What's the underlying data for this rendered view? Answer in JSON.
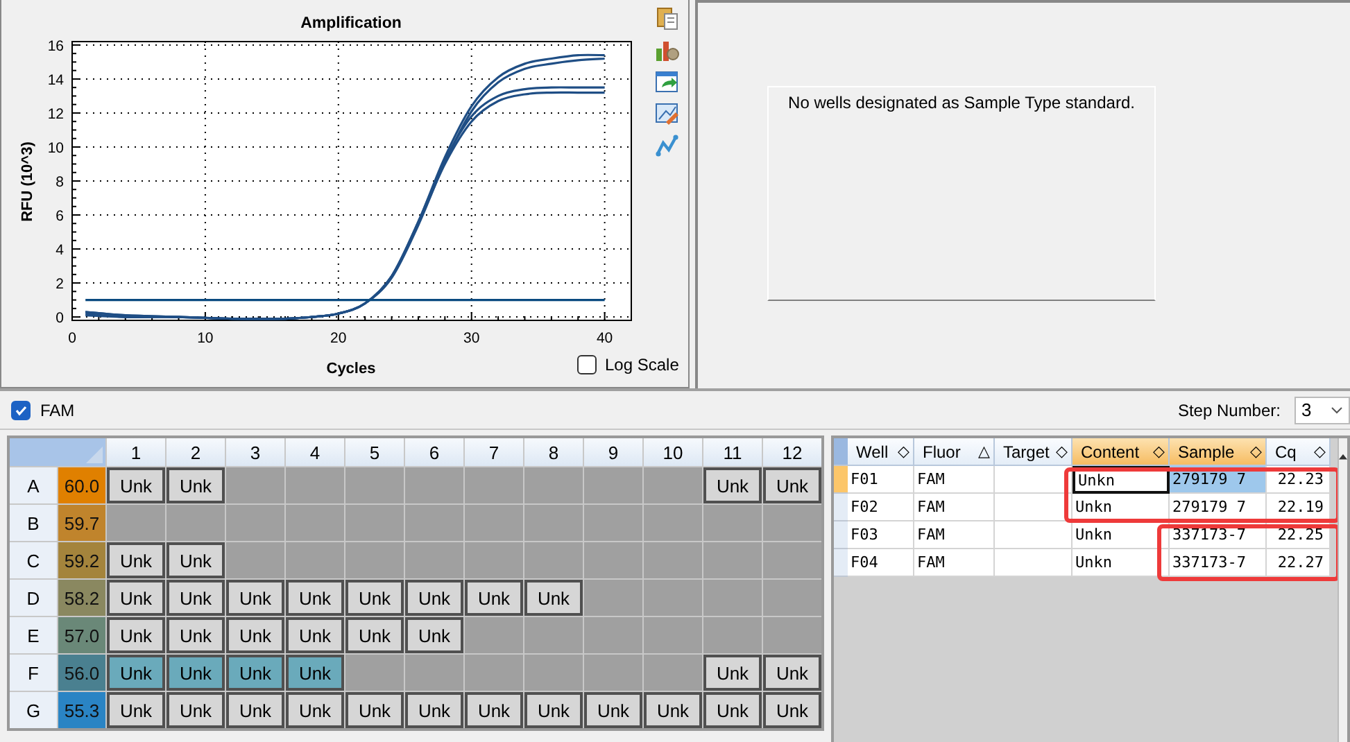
{
  "chart": {
    "chart_data": {
      "type": "line",
      "title": "Amplification",
      "xlabel": "Cycles",
      "ylabel": "RFU (10^3)",
      "x": [
        1,
        4,
        8,
        12,
        16,
        18,
        20,
        22,
        24,
        26,
        28,
        30,
        32,
        34,
        36,
        38,
        40
      ],
      "series": [
        {
          "color": "#1f4e85",
          "values": [
            0.3,
            0.1,
            0,
            -0.1,
            -0.1,
            0,
            0.2,
            0.8,
            2.4,
            5.6,
            9.4,
            12.4,
            14.1,
            14.9,
            15.2,
            15.4,
            15.4
          ]
        },
        {
          "color": "#1f4e85",
          "values": [
            0.1,
            0,
            0,
            -0.1,
            -0.1,
            0,
            0.2,
            0.8,
            2.3,
            5.4,
            9.1,
            12.1,
            13.8,
            14.6,
            14.9,
            15.1,
            15.2
          ]
        },
        {
          "color": "#1f4e85",
          "values": [
            0.3,
            0.1,
            0,
            -0.1,
            -0.1,
            0,
            0.2,
            0.8,
            2.4,
            5.6,
            9.2,
            11.8,
            13.0,
            13.4,
            13.5,
            13.5,
            13.5
          ]
        },
        {
          "color": "#1f4e85",
          "values": [
            0.2,
            0,
            0,
            -0.1,
            -0.1,
            0,
            0.2,
            0.8,
            2.4,
            5.5,
            9.0,
            11.5,
            12.7,
            13.1,
            13.2,
            13.2,
            13.2
          ]
        },
        {
          "color": "#0a4a80",
          "values": [
            1,
            1,
            1,
            1,
            1,
            1,
            1,
            1,
            1,
            1,
            1,
            1,
            1,
            1,
            1,
            1,
            1
          ]
        }
      ],
      "xlim": [
        0,
        42
      ],
      "ylim": [
        -0.2,
        16.2
      ],
      "xticks": [
        0,
        10,
        20,
        30,
        40
      ],
      "yticks": [
        0,
        2,
        4,
        6,
        8,
        10,
        12,
        14,
        16
      ],
      "grid": true
    },
    "log_scale": {
      "label": "Log Scale",
      "checked": false
    }
  },
  "standard_curve": {
    "message": "No wells designated as Sample Type standard."
  },
  "fluor_filter": {
    "label": "FAM",
    "checked": true
  },
  "step_number": {
    "label": "Step Number:",
    "value": "3"
  },
  "plate": {
    "columns": [
      "1",
      "2",
      "3",
      "4",
      "5",
      "6",
      "7",
      "8",
      "9",
      "10",
      "11",
      "12"
    ],
    "rows": [
      {
        "label": "A",
        "temp": "60.0",
        "color": "#e08000",
        "wells": [
          {
            "kind": "unk",
            "content": "Unk",
            "selected": false
          },
          {
            "kind": "unk",
            "content": "Unk",
            "selected": false
          },
          {
            "kind": "empty",
            "selected": false
          },
          {
            "kind": "empty",
            "selected": false
          },
          {
            "kind": "empty",
            "selected": false
          },
          {
            "kind": "empty",
            "selected": false
          },
          {
            "kind": "empty",
            "selected": false
          },
          {
            "kind": "empty",
            "selected": false
          },
          {
            "kind": "empty",
            "selected": false
          },
          {
            "kind": "empty",
            "selected": false
          },
          {
            "kind": "unk",
            "content": "Unk",
            "selected": false
          },
          {
            "kind": "unk",
            "content": "Unk",
            "selected": false
          }
        ]
      },
      {
        "label": "B",
        "temp": "59.7",
        "color": "#c0842c",
        "wells": [
          {
            "kind": "empty",
            "selected": false
          },
          {
            "kind": "empty",
            "selected": false
          },
          {
            "kind": "empty",
            "selected": false
          },
          {
            "kind": "empty",
            "selected": false
          },
          {
            "kind": "empty",
            "selected": false
          },
          {
            "kind": "empty",
            "selected": false
          },
          {
            "kind": "empty",
            "selected": false
          },
          {
            "kind": "empty",
            "selected": false
          },
          {
            "kind": "empty",
            "selected": false
          },
          {
            "kind": "empty",
            "selected": false
          },
          {
            "kind": "empty",
            "selected": false
          },
          {
            "kind": "empty",
            "selected": false
          }
        ]
      },
      {
        "label": "C",
        "temp": "59.2",
        "color": "#a4843c",
        "wells": [
          {
            "kind": "unk",
            "content": "Unk",
            "selected": false
          },
          {
            "kind": "unk",
            "content": "Unk",
            "selected": false
          },
          {
            "kind": "empty",
            "selected": false
          },
          {
            "kind": "empty",
            "selected": false
          },
          {
            "kind": "empty",
            "selected": false
          },
          {
            "kind": "empty",
            "selected": false
          },
          {
            "kind": "empty",
            "selected": false
          },
          {
            "kind": "empty",
            "selected": false
          },
          {
            "kind": "empty",
            "selected": false
          },
          {
            "kind": "empty",
            "selected": false
          },
          {
            "kind": "empty",
            "selected": false
          },
          {
            "kind": "empty",
            "selected": false
          }
        ]
      },
      {
        "label": "D",
        "temp": "58.2",
        "color": "#8a8860",
        "wells": [
          {
            "kind": "unk",
            "content": "Unk",
            "selected": false
          },
          {
            "kind": "unk",
            "content": "Unk",
            "selected": false
          },
          {
            "kind": "unk",
            "content": "Unk",
            "selected": false
          },
          {
            "kind": "unk",
            "content": "Unk",
            "selected": false
          },
          {
            "kind": "unk",
            "content": "Unk",
            "selected": false
          },
          {
            "kind": "unk",
            "content": "Unk",
            "selected": false
          },
          {
            "kind": "unk",
            "content": "Unk",
            "selected": false
          },
          {
            "kind": "unk",
            "content": "Unk",
            "selected": false
          },
          {
            "kind": "empty",
            "selected": false
          },
          {
            "kind": "empty",
            "selected": false
          },
          {
            "kind": "empty",
            "selected": false
          },
          {
            "kind": "empty",
            "selected": false
          }
        ]
      },
      {
        "label": "E",
        "temp": "57.0",
        "color": "#6a8878",
        "wells": [
          {
            "kind": "unk",
            "content": "Unk",
            "selected": false
          },
          {
            "kind": "unk",
            "content": "Unk",
            "selected": false
          },
          {
            "kind": "unk",
            "content": "Unk",
            "selected": false
          },
          {
            "kind": "unk",
            "content": "Unk",
            "selected": false
          },
          {
            "kind": "unk",
            "content": "Unk",
            "selected": false
          },
          {
            "kind": "unk",
            "content": "Unk",
            "selected": false
          },
          {
            "kind": "empty",
            "selected": false
          },
          {
            "kind": "empty",
            "selected": false
          },
          {
            "kind": "empty",
            "selected": false
          },
          {
            "kind": "empty",
            "selected": false
          },
          {
            "kind": "empty",
            "selected": false
          },
          {
            "kind": "empty",
            "selected": false
          }
        ]
      },
      {
        "label": "F",
        "temp": "56.0",
        "color": "#4a8090",
        "wells": [
          {
            "kind": "unk",
            "content": "Unk",
            "selected": true
          },
          {
            "kind": "unk",
            "content": "Unk",
            "selected": true
          },
          {
            "kind": "unk",
            "content": "Unk",
            "selected": true
          },
          {
            "kind": "unk",
            "content": "Unk",
            "selected": true
          },
          {
            "kind": "empty",
            "selected": false
          },
          {
            "kind": "empty",
            "selected": false
          },
          {
            "kind": "empty",
            "selected": false
          },
          {
            "kind": "empty",
            "selected": false
          },
          {
            "kind": "empty",
            "selected": false
          },
          {
            "kind": "empty",
            "selected": false
          },
          {
            "kind": "unk",
            "content": "Unk",
            "selected": false
          },
          {
            "kind": "unk",
            "content": "Unk",
            "selected": false
          }
        ]
      },
      {
        "label": "G",
        "temp": "55.3",
        "color": "#2a84c4",
        "wells": [
          {
            "kind": "unk",
            "content": "Unk",
            "selected": false
          },
          {
            "kind": "unk",
            "content": "Unk",
            "selected": false
          },
          {
            "kind": "unk",
            "content": "Unk",
            "selected": false
          },
          {
            "kind": "unk",
            "content": "Unk",
            "selected": false
          },
          {
            "kind": "unk",
            "content": "Unk",
            "selected": false
          },
          {
            "kind": "unk",
            "content": "Unk",
            "selected": false
          },
          {
            "kind": "unk",
            "content": "Unk",
            "selected": false
          },
          {
            "kind": "unk",
            "content": "Unk",
            "selected": false
          },
          {
            "kind": "unk",
            "content": "Unk",
            "selected": false
          },
          {
            "kind": "unk",
            "content": "Unk",
            "selected": false
          },
          {
            "kind": "unk",
            "content": "Unk",
            "selected": false
          },
          {
            "kind": "unk",
            "content": "Unk",
            "selected": false
          }
        ]
      }
    ]
  },
  "results_table": {
    "columns": [
      {
        "label": "Well",
        "sort_mark": "◇",
        "highlighted": false
      },
      {
        "label": "Fluor",
        "sort_mark": "△",
        "highlighted": false
      },
      {
        "label": "Target",
        "sort_mark": "◇",
        "highlighted": false
      },
      {
        "label": "Content",
        "sort_mark": "◇",
        "highlighted": true
      },
      {
        "label": "Sample",
        "sort_mark": "◇",
        "highlighted": true
      },
      {
        "label": "Cq",
        "sort_mark": "◇",
        "highlighted": false
      }
    ],
    "rows": [
      {
        "well": "F01",
        "fluor": "FAM",
        "content": "Unkn",
        "sample": "279179 7",
        "cq": "22.23",
        "selected": true,
        "content_focused": true,
        "sample_selected": true
      },
      {
        "well": "F02",
        "fluor": "FAM",
        "content": "Unkn",
        "sample": "279179 7",
        "cq": "22.19",
        "selected": false,
        "content_focused": false,
        "sample_selected": false
      },
      {
        "well": "F03",
        "fluor": "FAM",
        "content": "Unkn",
        "sample": "337173-7",
        "cq": "22.25",
        "selected": false,
        "content_focused": false,
        "sample_selected": false
      },
      {
        "well": "F04",
        "fluor": "FAM",
        "content": "Unkn",
        "sample": "337173-7",
        "cq": "22.27",
        "selected": false,
        "content_focused": false,
        "sample_selected": false
      }
    ],
    "annotations": [
      {
        "kind": "frame",
        "color": "#ee3a3a"
      },
      {
        "kind": "frame",
        "color": "#ee3a3a"
      }
    ]
  }
}
